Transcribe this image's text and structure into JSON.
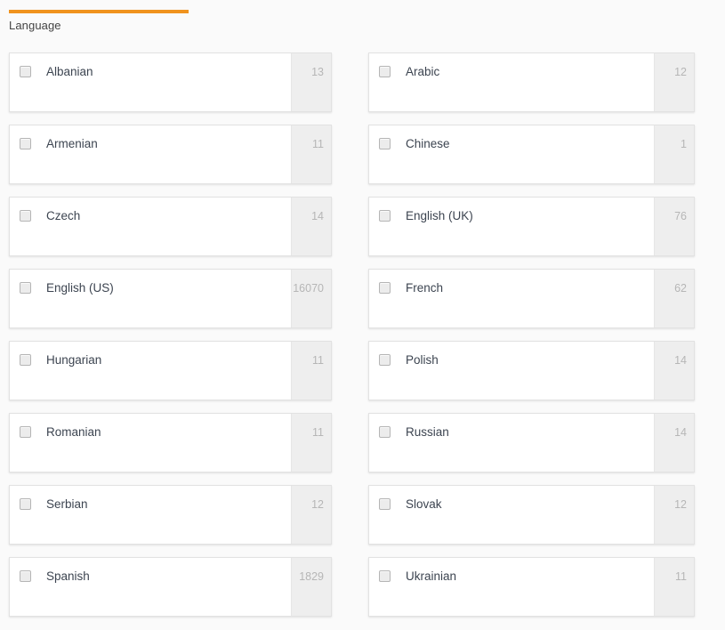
{
  "facet": {
    "title": "Language",
    "accent_color": "#f0931e",
    "count_color": "#b6b6b6",
    "label_color": "#3c4450",
    "checkbox_icon": "checkbox-unchecked-icon",
    "columns": [
      {
        "name": "left",
        "items": [
          {
            "label": "Albanian",
            "count": "13"
          },
          {
            "label": "Armenian",
            "count": "11"
          },
          {
            "label": "Czech",
            "count": "14"
          },
          {
            "label": "English (US)",
            "count": "16070"
          },
          {
            "label": "Hungarian",
            "count": "11"
          },
          {
            "label": "Romanian",
            "count": "11"
          },
          {
            "label": "Serbian",
            "count": "12"
          },
          {
            "label": "Spanish",
            "count": "1829"
          }
        ]
      },
      {
        "name": "right",
        "items": [
          {
            "label": "Arabic",
            "count": "12"
          },
          {
            "label": "Chinese",
            "count": "1"
          },
          {
            "label": "English (UK)",
            "count": "76"
          },
          {
            "label": "French",
            "count": "62"
          },
          {
            "label": "Polish",
            "count": "14"
          },
          {
            "label": "Russian",
            "count": "14"
          },
          {
            "label": "Slovak",
            "count": "12"
          },
          {
            "label": "Ukrainian",
            "count": "11"
          }
        ]
      }
    ]
  }
}
